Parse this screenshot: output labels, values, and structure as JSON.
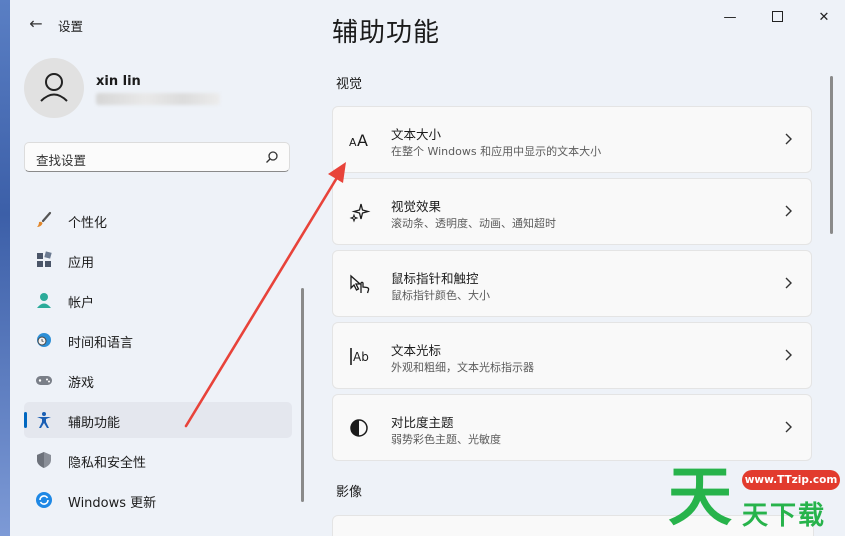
{
  "window": {
    "title": "设置",
    "back_glyph": "←",
    "min_glyph": "—",
    "close_glyph": "✕"
  },
  "profile": {
    "name": "xin lin"
  },
  "search": {
    "placeholder": "查找设置"
  },
  "nav": {
    "items": [
      {
        "label": "个性化",
        "icon": "brush-icon",
        "active": false
      },
      {
        "label": "应用",
        "icon": "apps-icon",
        "active": false
      },
      {
        "label": "帐户",
        "icon": "account-icon",
        "active": false
      },
      {
        "label": "时间和语言",
        "icon": "globe-clock-icon",
        "active": false
      },
      {
        "label": "游戏",
        "icon": "gamepad-icon",
        "active": false
      },
      {
        "label": "辅助功能",
        "icon": "accessibility-icon",
        "active": true
      },
      {
        "label": "隐私和安全性",
        "icon": "shield-icon",
        "active": false
      },
      {
        "label": "Windows 更新",
        "icon": "windows-update-icon",
        "active": false
      }
    ]
  },
  "main": {
    "title": "辅助功能",
    "section_vision": "视觉",
    "section_media": "影像",
    "cards": [
      {
        "title": "文本大小",
        "subtitle": "在整个 Windows 和应用中显示的文本大小",
        "icon": "text-size-icon"
      },
      {
        "title": "视觉效果",
        "subtitle": "滚动条、透明度、动画、通知超时",
        "icon": "sparkle-icon"
      },
      {
        "title": "鼠标指针和触控",
        "subtitle": "鼠标指针颜色、大小",
        "icon": "pointer-touch-icon"
      },
      {
        "title": "文本光标",
        "subtitle": "外观和粗细，文本光标指示器",
        "icon": "text-cursor-icon"
      },
      {
        "title": "对比度主题",
        "subtitle": "弱势彩色主题、光敏度",
        "icon": "contrast-icon"
      }
    ]
  },
  "watermark": {
    "glyph": "天",
    "url": "www.TTzip.com",
    "text": "天下载"
  },
  "colors": {
    "accent": "#0067c0",
    "arrow": "#e8433a",
    "watermark_green": "#27b34b"
  }
}
